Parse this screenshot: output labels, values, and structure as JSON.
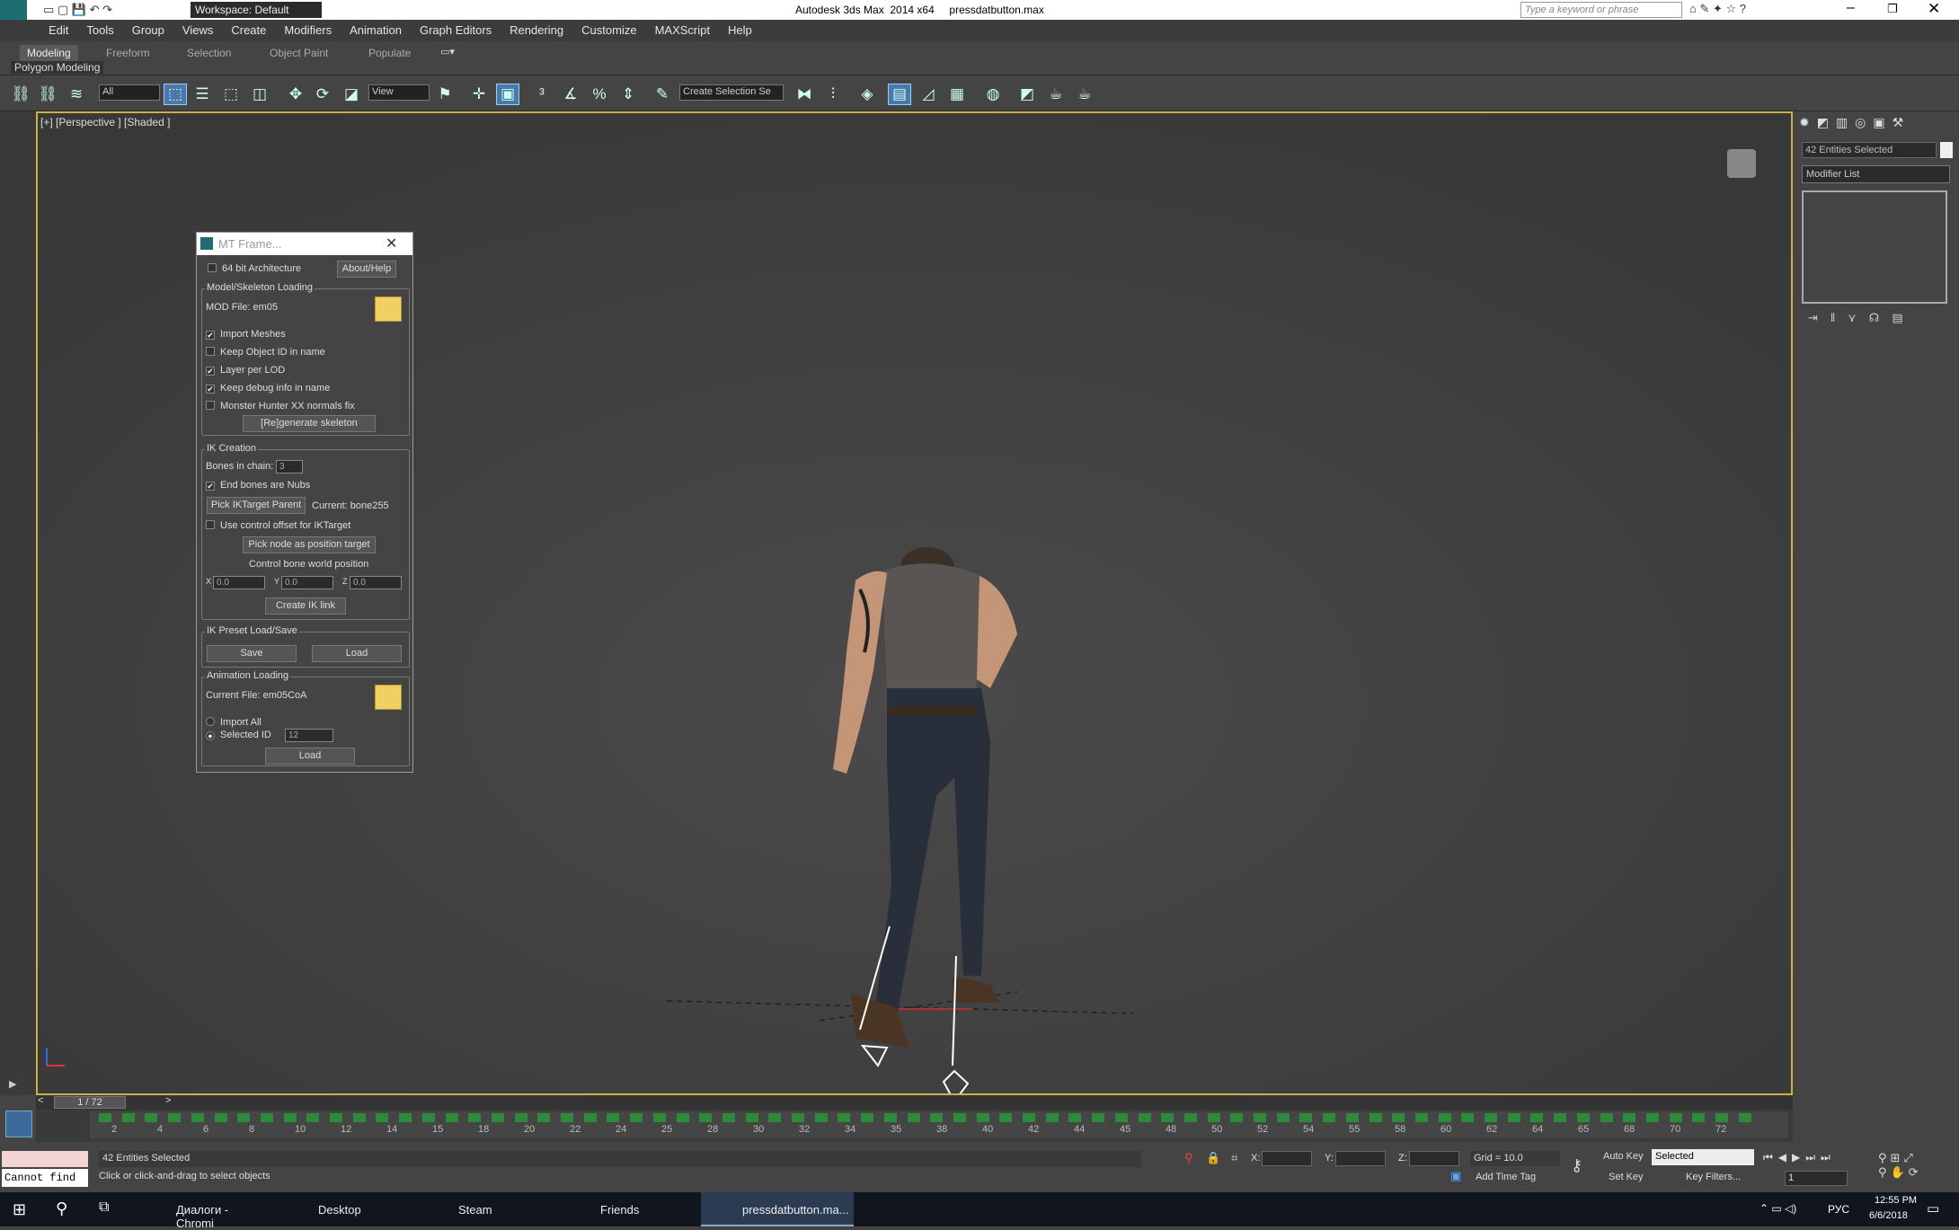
{
  "window": {
    "title": "Autodesk 3ds Max  2014 x64     pressdatbutton.max",
    "workspace": "Workspace: Default",
    "search_placeholder": "Type a keyword or phrase"
  },
  "menu": [
    "Edit",
    "Tools",
    "Group",
    "Views",
    "Create",
    "Modifiers",
    "Animation",
    "Graph Editors",
    "Rendering",
    "Customize",
    "MAXScript",
    "Help"
  ],
  "ribbon": {
    "tabs": [
      "Modeling",
      "Freeform",
      "Selection",
      "Object Paint",
      "Populate"
    ],
    "sub": "Polygon Modeling"
  },
  "toolbar": {
    "filter": "All",
    "refcoord": "View",
    "selset": "Create Selection Se"
  },
  "viewport": {
    "label": "[+] [Perspective ] [Shaded ]"
  },
  "cmdpanel": {
    "selection": "42 Entities Selected",
    "modifier_list": "Modifier List"
  },
  "dialog": {
    "title": "MT Frame...",
    "arch": "64 bit Architecture",
    "about": "About/Help",
    "model": {
      "legend": "Model/Skeleton Loading",
      "file": "MOD File: em05",
      "opts": [
        {
          "label": "Import Meshes",
          "checked": "✔"
        },
        {
          "label": "Keep Object ID in name",
          "checked": ""
        },
        {
          "label": "Layer per LOD",
          "checked": "✔"
        },
        {
          "label": "Keep debug info in name",
          "checked": "✔"
        },
        {
          "label": "Monster Hunter XX normals fix",
          "checked": ""
        }
      ],
      "regen": "[Re]generate skeleton"
    },
    "ik": {
      "legend": "IK Creation",
      "bones_label": "Bones in chain:",
      "bones_value": "3",
      "end_nubs": "End bones are Nubs",
      "end_nubs_checked": "✔",
      "pick_parent": "Pick IKTarget Parent",
      "current": "Current: bone255",
      "control_offset": "Use control offset for IKTarget",
      "pick_node": "Pick node as position target",
      "world_pos": "Control bone world position",
      "x": "0.0",
      "y": "0.0",
      "z": "0.0",
      "x_label": "X",
      "y_label": "Y",
      "z_label": "Z",
      "create": "Create IK link"
    },
    "preset": {
      "legend": "IK Preset Load/Save",
      "save": "Save",
      "load": "Load"
    },
    "anim": {
      "legend": "Animation Loading",
      "file": "Current File: em05CoA",
      "import_all": "Import All",
      "selected_id": "Selected ID",
      "id_value": "12",
      "load": "Load"
    }
  },
  "timeline": {
    "frame": "1 / 72",
    "ticks": [
      "2",
      "4",
      "6",
      "8",
      "10",
      "12",
      "14",
      "15",
      "18",
      "20",
      "22",
      "24",
      "25",
      "28",
      "30",
      "32",
      "34",
      "35",
      "38",
      "40",
      "42",
      "44",
      "45",
      "48",
      "50",
      "52",
      "54",
      "55",
      "58",
      "60",
      "62",
      "64",
      "65",
      "68",
      "70",
      "72"
    ]
  },
  "status": {
    "selected": "42 Entities Selected",
    "prompt": "Click or click-and-drag to select objects",
    "script": "Cannot find",
    "x": "X:",
    "y": "Y:",
    "z": "Z:",
    "grid": "Grid = 10.0",
    "addtime": "Add Time Tag",
    "autokey": "Auto Key",
    "setkey": "Set Key",
    "keymode": "Selected",
    "keyfilters": "Key Filters...",
    "frame": "1"
  },
  "taskbar": {
    "items": [
      "Диалоги - Chromi",
      "Desktop",
      "Steam",
      "Friends",
      "pressdatbutton.ma..."
    ],
    "lang": "РУС",
    "time": "12:55 PM",
    "date": "6/6/2018"
  }
}
